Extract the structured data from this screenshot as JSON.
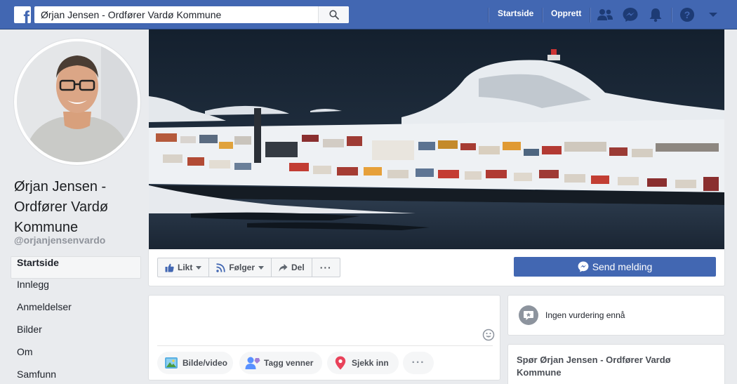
{
  "topbar": {
    "logo_letter": "f",
    "search_value": "Ørjan Jensen - Ordfører Vardø Kommune",
    "nav_home": "Startside",
    "nav_create": "Opprett",
    "icons": [
      "friends-icon",
      "messenger-icon",
      "notifications-icon",
      "help-icon",
      "account-menu-caret-icon"
    ],
    "bar_color": "#4267b2"
  },
  "profile": {
    "name": "Ørjan Jensen - Ordfører Vardø Kommune",
    "handle": "@orjanjensenvardo"
  },
  "sidebar": {
    "items": [
      {
        "label": "Startside",
        "active": true
      },
      {
        "label": "Innlegg"
      },
      {
        "label": "Anmeldelser"
      },
      {
        "label": "Bilder"
      },
      {
        "label": "Om"
      },
      {
        "label": "Samfunn"
      }
    ]
  },
  "actions": {
    "like": "Likt",
    "follow": "Følger",
    "share": "Del",
    "more": "···",
    "send_message": "Send melding"
  },
  "composer": {
    "photo_video": "Bilde/video",
    "tag_friends": "Tagg venner",
    "check_in": "Sjekk inn",
    "more": "···"
  },
  "reviews": {
    "text": "Ingen vurdering ennå"
  },
  "ask": {
    "title": "Spør Ørjan Jensen - Ordfører Vardø Kommune"
  },
  "colors": {
    "brand": "#4267b2",
    "background": "#e9ebee"
  }
}
